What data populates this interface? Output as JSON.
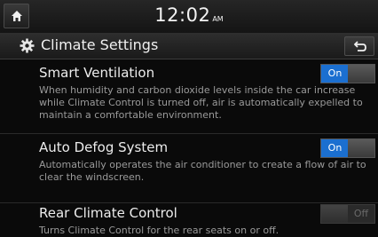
{
  "status_bar": {
    "time": "12:02",
    "ampm": "AM",
    "home_icon": "home-icon"
  },
  "title_bar": {
    "title": "Climate Settings",
    "gear_icon": "gear-icon",
    "back_icon": "back-arrow-icon"
  },
  "settings": [
    {
      "title": "Smart Ventilation",
      "desc": "When humidity and carbon dioxide levels inside the car increase while Climate Control is turned off, air is automatically expelled to maintain a comfortable environment.",
      "toggle_label": "On",
      "state": "on"
    },
    {
      "title": "Auto Defog System",
      "desc": "Automatically operates the air conditioner to create a flow of air to clear the windscreen.",
      "toggle_label": "On",
      "state": "on"
    },
    {
      "title": "Rear Climate Control",
      "desc": "Turns Climate Control for the rear seats on or off.",
      "toggle_label": "Off",
      "state": "off"
    }
  ],
  "colors": {
    "accent": "#1b6fd0",
    "background": "#0a0a0a"
  }
}
